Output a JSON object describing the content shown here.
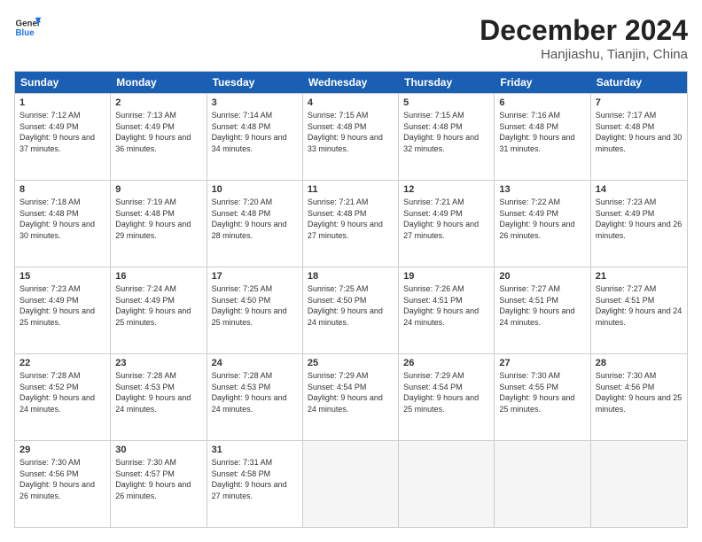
{
  "header": {
    "logo_general": "General",
    "logo_blue": "Blue",
    "month": "December 2024",
    "location": "Hanjiashu, Tianjin, China"
  },
  "weekdays": [
    "Sunday",
    "Monday",
    "Tuesday",
    "Wednesday",
    "Thursday",
    "Friday",
    "Saturday"
  ],
  "rows": [
    [
      {
        "day": "1",
        "sunrise": "Sunrise: 7:12 AM",
        "sunset": "Sunset: 4:49 PM",
        "daylight": "Daylight: 9 hours and 37 minutes."
      },
      {
        "day": "2",
        "sunrise": "Sunrise: 7:13 AM",
        "sunset": "Sunset: 4:49 PM",
        "daylight": "Daylight: 9 hours and 36 minutes."
      },
      {
        "day": "3",
        "sunrise": "Sunrise: 7:14 AM",
        "sunset": "Sunset: 4:48 PM",
        "daylight": "Daylight: 9 hours and 34 minutes."
      },
      {
        "day": "4",
        "sunrise": "Sunrise: 7:15 AM",
        "sunset": "Sunset: 4:48 PM",
        "daylight": "Daylight: 9 hours and 33 minutes."
      },
      {
        "day": "5",
        "sunrise": "Sunrise: 7:15 AM",
        "sunset": "Sunset: 4:48 PM",
        "daylight": "Daylight: 9 hours and 32 minutes."
      },
      {
        "day": "6",
        "sunrise": "Sunrise: 7:16 AM",
        "sunset": "Sunset: 4:48 PM",
        "daylight": "Daylight: 9 hours and 31 minutes."
      },
      {
        "day": "7",
        "sunrise": "Sunrise: 7:17 AM",
        "sunset": "Sunset: 4:48 PM",
        "daylight": "Daylight: 9 hours and 30 minutes."
      }
    ],
    [
      {
        "day": "8",
        "sunrise": "Sunrise: 7:18 AM",
        "sunset": "Sunset: 4:48 PM",
        "daylight": "Daylight: 9 hours and 30 minutes."
      },
      {
        "day": "9",
        "sunrise": "Sunrise: 7:19 AM",
        "sunset": "Sunset: 4:48 PM",
        "daylight": "Daylight: 9 hours and 29 minutes."
      },
      {
        "day": "10",
        "sunrise": "Sunrise: 7:20 AM",
        "sunset": "Sunset: 4:48 PM",
        "daylight": "Daylight: 9 hours and 28 minutes."
      },
      {
        "day": "11",
        "sunrise": "Sunrise: 7:21 AM",
        "sunset": "Sunset: 4:48 PM",
        "daylight": "Daylight: 9 hours and 27 minutes."
      },
      {
        "day": "12",
        "sunrise": "Sunrise: 7:21 AM",
        "sunset": "Sunset: 4:49 PM",
        "daylight": "Daylight: 9 hours and 27 minutes."
      },
      {
        "day": "13",
        "sunrise": "Sunrise: 7:22 AM",
        "sunset": "Sunset: 4:49 PM",
        "daylight": "Daylight: 9 hours and 26 minutes."
      },
      {
        "day": "14",
        "sunrise": "Sunrise: 7:23 AM",
        "sunset": "Sunset: 4:49 PM",
        "daylight": "Daylight: 9 hours and 26 minutes."
      }
    ],
    [
      {
        "day": "15",
        "sunrise": "Sunrise: 7:23 AM",
        "sunset": "Sunset: 4:49 PM",
        "daylight": "Daylight: 9 hours and 25 minutes."
      },
      {
        "day": "16",
        "sunrise": "Sunrise: 7:24 AM",
        "sunset": "Sunset: 4:49 PM",
        "daylight": "Daylight: 9 hours and 25 minutes."
      },
      {
        "day": "17",
        "sunrise": "Sunrise: 7:25 AM",
        "sunset": "Sunset: 4:50 PM",
        "daylight": "Daylight: 9 hours and 25 minutes."
      },
      {
        "day": "18",
        "sunrise": "Sunrise: 7:25 AM",
        "sunset": "Sunset: 4:50 PM",
        "daylight": "Daylight: 9 hours and 24 minutes."
      },
      {
        "day": "19",
        "sunrise": "Sunrise: 7:26 AM",
        "sunset": "Sunset: 4:51 PM",
        "daylight": "Daylight: 9 hours and 24 minutes."
      },
      {
        "day": "20",
        "sunrise": "Sunrise: 7:27 AM",
        "sunset": "Sunset: 4:51 PM",
        "daylight": "Daylight: 9 hours and 24 minutes."
      },
      {
        "day": "21",
        "sunrise": "Sunrise: 7:27 AM",
        "sunset": "Sunset: 4:51 PM",
        "daylight": "Daylight: 9 hours and 24 minutes."
      }
    ],
    [
      {
        "day": "22",
        "sunrise": "Sunrise: 7:28 AM",
        "sunset": "Sunset: 4:52 PM",
        "daylight": "Daylight: 9 hours and 24 minutes."
      },
      {
        "day": "23",
        "sunrise": "Sunrise: 7:28 AM",
        "sunset": "Sunset: 4:53 PM",
        "daylight": "Daylight: 9 hours and 24 minutes."
      },
      {
        "day": "24",
        "sunrise": "Sunrise: 7:28 AM",
        "sunset": "Sunset: 4:53 PM",
        "daylight": "Daylight: 9 hours and 24 minutes."
      },
      {
        "day": "25",
        "sunrise": "Sunrise: 7:29 AM",
        "sunset": "Sunset: 4:54 PM",
        "daylight": "Daylight: 9 hours and 24 minutes."
      },
      {
        "day": "26",
        "sunrise": "Sunrise: 7:29 AM",
        "sunset": "Sunset: 4:54 PM",
        "daylight": "Daylight: 9 hours and 25 minutes."
      },
      {
        "day": "27",
        "sunrise": "Sunrise: 7:30 AM",
        "sunset": "Sunset: 4:55 PM",
        "daylight": "Daylight: 9 hours and 25 minutes."
      },
      {
        "day": "28",
        "sunrise": "Sunrise: 7:30 AM",
        "sunset": "Sunset: 4:56 PM",
        "daylight": "Daylight: 9 hours and 25 minutes."
      }
    ],
    [
      {
        "day": "29",
        "sunrise": "Sunrise: 7:30 AM",
        "sunset": "Sunset: 4:56 PM",
        "daylight": "Daylight: 9 hours and 26 minutes."
      },
      {
        "day": "30",
        "sunrise": "Sunrise: 7:30 AM",
        "sunset": "Sunset: 4:57 PM",
        "daylight": "Daylight: 9 hours and 26 minutes."
      },
      {
        "day": "31",
        "sunrise": "Sunrise: 7:31 AM",
        "sunset": "Sunset: 4:58 PM",
        "daylight": "Daylight: 9 hours and 27 minutes."
      },
      null,
      null,
      null,
      null
    ]
  ]
}
